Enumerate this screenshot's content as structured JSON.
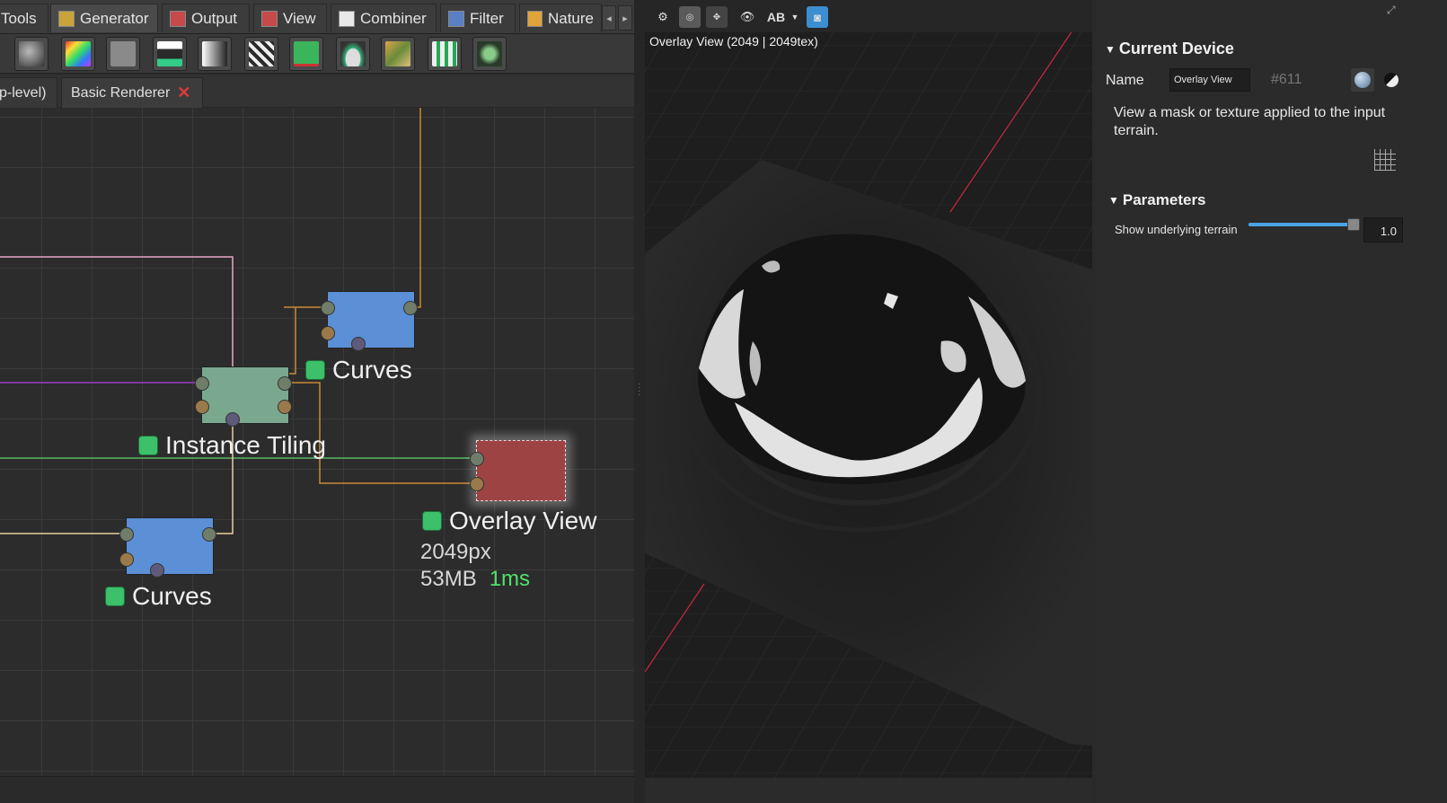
{
  "category_tabs": [
    {
      "label": "Tools",
      "icon": "tools-icon"
    },
    {
      "label": "Generator",
      "icon": "generator-icon",
      "active": true
    },
    {
      "label": "Output",
      "icon": "output-icon"
    },
    {
      "label": "View",
      "icon": "view-icon"
    },
    {
      "label": "Combiner",
      "icon": "combiner-icon"
    },
    {
      "label": "Filter",
      "icon": "filter-icon"
    },
    {
      "label": "Nature",
      "icon": "nature-icon"
    }
  ],
  "toolbar_tools": [
    "terrain-tool-icon",
    "color-map-icon",
    "gray-tool-icon",
    "save-disk-icon",
    "gradient-icon",
    "patterns-icon",
    "green-square-icon",
    "mound-icon",
    "erosion-map-icon",
    "grid-tiles-icon",
    "voronoi-icon"
  ],
  "doc_tabs": {
    "top_level": "p-level)",
    "basic_renderer": "Basic Renderer"
  },
  "nodes": {
    "curves_top": {
      "label": "Curves"
    },
    "instance_tiling": {
      "label": "Instance Tiling"
    },
    "overlay_view": {
      "label": "Overlay View",
      "resolution": "2049px",
      "memory": "53MB",
      "time": "1ms"
    },
    "curves_bottom": {
      "label": "Curves"
    }
  },
  "viewport": {
    "title": "Overlay View (2049 | 2049tex)",
    "toolbar": [
      "settings-gear-icon",
      "orbit-icon",
      "free-camera-icon",
      "eye-icon",
      "ab-compare-icon",
      "dropdown-arrow-icon",
      "camera-icon"
    ],
    "ab_label": "AB"
  },
  "properties": {
    "current_device_title": "Current Device",
    "name_label": "Name",
    "name_value": "Overlay View",
    "device_id": "#611",
    "description": "View a mask or texture applied to the input terrain.",
    "parameters_title": "Parameters",
    "param_label": "Show underlying terrain",
    "param_value": "1.0",
    "param_fraction": 1.0
  },
  "colors": {
    "accent_blue": "#4ba3e6",
    "node_blue": "#5b8fd6",
    "node_green": "#7aa88f",
    "node_red": "#9e4343",
    "status_green": "#3cc06a",
    "time_green": "#4de36a"
  }
}
